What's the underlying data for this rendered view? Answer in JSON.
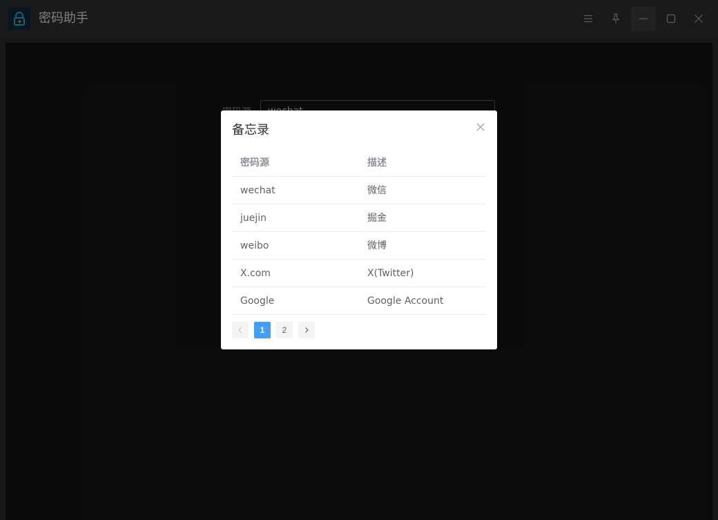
{
  "window": {
    "title": "密码助手"
  },
  "background_form": {
    "label": "密码源",
    "value": "wechat"
  },
  "dialog": {
    "title": "备忘录",
    "columns": [
      "密码源",
      "描述"
    ],
    "rows": [
      {
        "source": "wechat",
        "desc": "微信"
      },
      {
        "source": "juejin",
        "desc": "掘金"
      },
      {
        "source": "weibo",
        "desc": "微博"
      },
      {
        "source": "X.com",
        "desc": "X(Twitter)"
      },
      {
        "source": "Google",
        "desc": "Google Account"
      }
    ],
    "pagination": {
      "pages": [
        "1",
        "2"
      ],
      "current": "1"
    }
  },
  "colors": {
    "accent": "#409eff",
    "titlebar": "#2f3034",
    "content_bg": "#141519"
  }
}
